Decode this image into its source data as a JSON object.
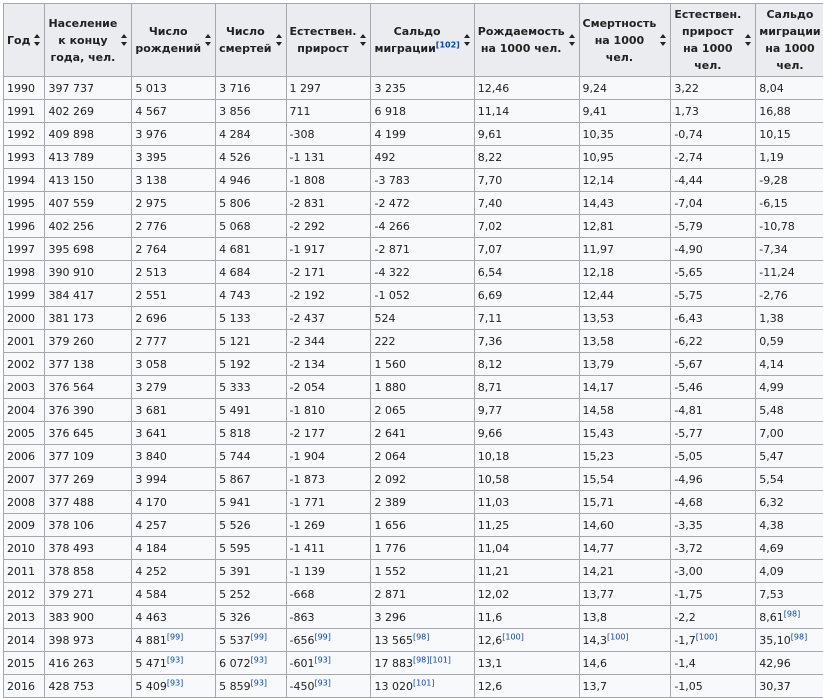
{
  "headers": [
    {
      "label": "Год",
      "ref": ""
    },
    {
      "label": "Население к концу года, чел.",
      "ref": ""
    },
    {
      "label": "Число рождений",
      "ref": ""
    },
    {
      "label": "Число смертей",
      "ref": ""
    },
    {
      "label": "Естествен. прирост",
      "ref": ""
    },
    {
      "label": "Сальдо миграции",
      "ref": "[102]"
    },
    {
      "label": "Рождаемость на 1000 чел.",
      "ref": ""
    },
    {
      "label": "Смертность на 1000 чел.",
      "ref": ""
    },
    {
      "label": "Естествен. прирост на 1000 чел.",
      "ref": ""
    },
    {
      "label": "Сальдо миграции на 1000 чел.",
      "ref": ""
    }
  ],
  "rows": [
    [
      {
        "v": "1990"
      },
      {
        "v": "397 737"
      },
      {
        "v": "5 013"
      },
      {
        "v": "3 716"
      },
      {
        "v": "1 297"
      },
      {
        "v": "3 235"
      },
      {
        "v": "12,46"
      },
      {
        "v": "9,24"
      },
      {
        "v": "3,22"
      },
      {
        "v": "8,04"
      }
    ],
    [
      {
        "v": "1991"
      },
      {
        "v": "402 269"
      },
      {
        "v": "4 567"
      },
      {
        "v": "3 856"
      },
      {
        "v": "711"
      },
      {
        "v": "6 918"
      },
      {
        "v": "11,14"
      },
      {
        "v": "9,41"
      },
      {
        "v": "1,73"
      },
      {
        "v": "16,88"
      }
    ],
    [
      {
        "v": "1992"
      },
      {
        "v": "409 898"
      },
      {
        "v": "3 976"
      },
      {
        "v": "4 284"
      },
      {
        "v": "-308"
      },
      {
        "v": "4 199"
      },
      {
        "v": "9,61"
      },
      {
        "v": "10,35"
      },
      {
        "v": "-0,74"
      },
      {
        "v": "10,15"
      }
    ],
    [
      {
        "v": "1993"
      },
      {
        "v": "413 789"
      },
      {
        "v": "3 395"
      },
      {
        "v": "4 526"
      },
      {
        "v": "-1 131"
      },
      {
        "v": "492"
      },
      {
        "v": "8,22"
      },
      {
        "v": "10,95"
      },
      {
        "v": "-2,74"
      },
      {
        "v": "1,19"
      }
    ],
    [
      {
        "v": "1994"
      },
      {
        "v": "413 150"
      },
      {
        "v": "3 138"
      },
      {
        "v": "4 946"
      },
      {
        "v": "-1 808"
      },
      {
        "v": "-3 783"
      },
      {
        "v": "7,70"
      },
      {
        "v": "12,14"
      },
      {
        "v": "-4,44"
      },
      {
        "v": "-9,28"
      }
    ],
    [
      {
        "v": "1995"
      },
      {
        "v": "407 559"
      },
      {
        "v": "2 975"
      },
      {
        "v": "5 806"
      },
      {
        "v": "-2 831"
      },
      {
        "v": "-2 472"
      },
      {
        "v": "7,40"
      },
      {
        "v": "14,43"
      },
      {
        "v": "-7,04"
      },
      {
        "v": "-6,15"
      }
    ],
    [
      {
        "v": "1996"
      },
      {
        "v": "402 256"
      },
      {
        "v": "2 776"
      },
      {
        "v": "5 068"
      },
      {
        "v": "-2 292"
      },
      {
        "v": "-4 266"
      },
      {
        "v": "7,02"
      },
      {
        "v": "12,81"
      },
      {
        "v": "-5,79"
      },
      {
        "v": "-10,78"
      }
    ],
    [
      {
        "v": "1997"
      },
      {
        "v": "395 698"
      },
      {
        "v": "2 764"
      },
      {
        "v": "4 681"
      },
      {
        "v": "-1 917"
      },
      {
        "v": "-2 871"
      },
      {
        "v": "7,07"
      },
      {
        "v": "11,97"
      },
      {
        "v": "-4,90"
      },
      {
        "v": "-7,34"
      }
    ],
    [
      {
        "v": "1998"
      },
      {
        "v": "390 910"
      },
      {
        "v": "2 513"
      },
      {
        "v": "4 684"
      },
      {
        "v": "-2 171"
      },
      {
        "v": "-4 322"
      },
      {
        "v": "6,54"
      },
      {
        "v": "12,18"
      },
      {
        "v": "-5,65"
      },
      {
        "v": "-11,24"
      }
    ],
    [
      {
        "v": "1999"
      },
      {
        "v": "384 417"
      },
      {
        "v": "2 551"
      },
      {
        "v": "4 743"
      },
      {
        "v": "-2 192"
      },
      {
        "v": "-1 052"
      },
      {
        "v": "6,69"
      },
      {
        "v": "12,44"
      },
      {
        "v": "-5,75"
      },
      {
        "v": "-2,76"
      }
    ],
    [
      {
        "v": "2000"
      },
      {
        "v": "381 173"
      },
      {
        "v": "2 696"
      },
      {
        "v": "5 133"
      },
      {
        "v": "-2 437"
      },
      {
        "v": "524"
      },
      {
        "v": "7,11"
      },
      {
        "v": "13,53"
      },
      {
        "v": "-6,43"
      },
      {
        "v": "1,38"
      }
    ],
    [
      {
        "v": "2001"
      },
      {
        "v": "379 260"
      },
      {
        "v": "2 777"
      },
      {
        "v": "5 121"
      },
      {
        "v": "-2 344"
      },
      {
        "v": "222"
      },
      {
        "v": "7,36"
      },
      {
        "v": "13,58"
      },
      {
        "v": "-6,22"
      },
      {
        "v": "0,59"
      }
    ],
    [
      {
        "v": "2002"
      },
      {
        "v": "377 138"
      },
      {
        "v": "3 058"
      },
      {
        "v": "5 192"
      },
      {
        "v": "-2 134"
      },
      {
        "v": "1 560"
      },
      {
        "v": "8,12"
      },
      {
        "v": "13,79"
      },
      {
        "v": "-5,67"
      },
      {
        "v": "4,14"
      }
    ],
    [
      {
        "v": "2003"
      },
      {
        "v": "376 564"
      },
      {
        "v": "3 279"
      },
      {
        "v": "5 333"
      },
      {
        "v": "-2 054"
      },
      {
        "v": "1 880"
      },
      {
        "v": "8,71"
      },
      {
        "v": "14,17"
      },
      {
        "v": "-5,46"
      },
      {
        "v": "4,99"
      }
    ],
    [
      {
        "v": "2004"
      },
      {
        "v": "376 390"
      },
      {
        "v": "3 681"
      },
      {
        "v": "5 491"
      },
      {
        "v": "-1 810"
      },
      {
        "v": "2 065"
      },
      {
        "v": "9,77"
      },
      {
        "v": "14,58"
      },
      {
        "v": "-4,81"
      },
      {
        "v": "5,48"
      }
    ],
    [
      {
        "v": "2005"
      },
      {
        "v": "376 645"
      },
      {
        "v": "3 641"
      },
      {
        "v": "5 818"
      },
      {
        "v": "-2 177"
      },
      {
        "v": "2 641"
      },
      {
        "v": "9,66"
      },
      {
        "v": "15,43"
      },
      {
        "v": "-5,77"
      },
      {
        "v": "7,00"
      }
    ],
    [
      {
        "v": "2006"
      },
      {
        "v": "377 109"
      },
      {
        "v": "3 840"
      },
      {
        "v": "5 744"
      },
      {
        "v": "-1 904"
      },
      {
        "v": "2 064"
      },
      {
        "v": "10,18"
      },
      {
        "v": "15,23"
      },
      {
        "v": "-5,05"
      },
      {
        "v": "5,47"
      }
    ],
    [
      {
        "v": "2007"
      },
      {
        "v": "377 269"
      },
      {
        "v": "3 994"
      },
      {
        "v": "5 867"
      },
      {
        "v": "-1 873"
      },
      {
        "v": "2 092"
      },
      {
        "v": "10,58"
      },
      {
        "v": "15,54"
      },
      {
        "v": "-4,96"
      },
      {
        "v": "5,54"
      }
    ],
    [
      {
        "v": "2008"
      },
      {
        "v": "377 488"
      },
      {
        "v": "4 170"
      },
      {
        "v": "5 941"
      },
      {
        "v": "-1 771"
      },
      {
        "v": "2 389"
      },
      {
        "v": "11,03"
      },
      {
        "v": "15,71"
      },
      {
        "v": "-4,68"
      },
      {
        "v": "6,32"
      }
    ],
    [
      {
        "v": "2009"
      },
      {
        "v": "378 106"
      },
      {
        "v": "4 257"
      },
      {
        "v": "5 526"
      },
      {
        "v": "-1 269"
      },
      {
        "v": "1 656"
      },
      {
        "v": "11,25"
      },
      {
        "v": "14,60"
      },
      {
        "v": "-3,35"
      },
      {
        "v": "4,38"
      }
    ],
    [
      {
        "v": "2010"
      },
      {
        "v": "378 493"
      },
      {
        "v": "4 184"
      },
      {
        "v": "5 595"
      },
      {
        "v": "-1 411"
      },
      {
        "v": "1 776"
      },
      {
        "v": "11,04"
      },
      {
        "v": "14,77"
      },
      {
        "v": "-3,72"
      },
      {
        "v": "4,69"
      }
    ],
    [
      {
        "v": "2011"
      },
      {
        "v": "378 858"
      },
      {
        "v": "4 252"
      },
      {
        "v": "5 391"
      },
      {
        "v": "-1 139"
      },
      {
        "v": "1 552"
      },
      {
        "v": "11,21"
      },
      {
        "v": "14,21"
      },
      {
        "v": "-3,00"
      },
      {
        "v": "4,09"
      }
    ],
    [
      {
        "v": "2012"
      },
      {
        "v": "379 271"
      },
      {
        "v": "4 584"
      },
      {
        "v": "5 252"
      },
      {
        "v": "-668"
      },
      {
        "v": "2 871"
      },
      {
        "v": "12,02"
      },
      {
        "v": "13,77"
      },
      {
        "v": "-1,75"
      },
      {
        "v": "7,53"
      }
    ],
    [
      {
        "v": "2013"
      },
      {
        "v": "383 900"
      },
      {
        "v": "4 463"
      },
      {
        "v": "5 326"
      },
      {
        "v": "-863"
      },
      {
        "v": "3 296"
      },
      {
        "v": "11,6"
      },
      {
        "v": "13,8"
      },
      {
        "v": "-2,2"
      },
      {
        "v": "8,61",
        "ref": "[98]"
      }
    ],
    [
      {
        "v": "2014"
      },
      {
        "v": "398 973"
      },
      {
        "v": "4 881",
        "ref": "[99]"
      },
      {
        "v": "5 537",
        "ref": "[99]"
      },
      {
        "v": "-656",
        "ref": "[99]"
      },
      {
        "v": "13 565",
        "ref": "[98]"
      },
      {
        "v": "12,6",
        "ref": "[100]"
      },
      {
        "v": "14,3",
        "ref": "[100]"
      },
      {
        "v": "-1,7",
        "ref": "[100]"
      },
      {
        "v": "35,10",
        "ref": "[98]"
      }
    ],
    [
      {
        "v": "2015"
      },
      {
        "v": "416 263"
      },
      {
        "v": "5 471",
        "ref": "[93]"
      },
      {
        "v": "6 072",
        "ref": "[93]"
      },
      {
        "v": "-601",
        "ref": "[93]"
      },
      {
        "v": "17 883",
        "ref": "[98][101]"
      },
      {
        "v": "13,1"
      },
      {
        "v": "14,6"
      },
      {
        "v": "-1,4"
      },
      {
        "v": "42,96"
      }
    ],
    [
      {
        "v": "2016"
      },
      {
        "v": "428 753"
      },
      {
        "v": "5 409",
        "ref": "[93]"
      },
      {
        "v": "5 859",
        "ref": "[93]"
      },
      {
        "v": "-450",
        "ref": "[93]"
      },
      {
        "v": "13 020",
        "ref": "[101]"
      },
      {
        "v": "12,6"
      },
      {
        "v": "13,7"
      },
      {
        "v": "-1,05"
      },
      {
        "v": "30,37"
      }
    ]
  ]
}
